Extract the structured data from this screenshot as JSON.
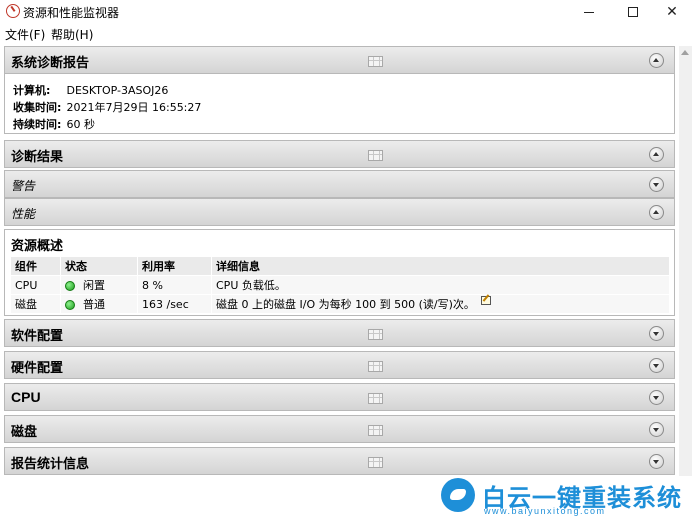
{
  "window": {
    "title": "资源和性能监视器"
  },
  "menu": {
    "file": "文件(F)",
    "help": "帮助(H)"
  },
  "report": {
    "title": "系统诊断报告",
    "computer_key": "计算机:",
    "computer_value": "DESKTOP-3ASOJ26",
    "collected_key": "收集时间:",
    "collected_value": "2021年7月29日  16:55:27",
    "duration_key": "持续时间:",
    "duration_value": "60 秒"
  },
  "sections": {
    "diagnostic_results": "诊断结果",
    "warning": "警告",
    "performance": "性能",
    "software_config": "软件配置",
    "hardware_config": "硬件配置",
    "cpu": "CPU",
    "disk": "磁盘",
    "report_stats": "报告统计信息"
  },
  "resource_overview": {
    "title": "资源概述",
    "columns": [
      "组件",
      "状态",
      "利用率",
      "详细信息"
    ],
    "rows": [
      {
        "component": "CPU",
        "status": "闲置",
        "utilization": "8 %",
        "details": "CPU 负载低。"
      },
      {
        "component": "磁盘",
        "status": "普通",
        "utilization": "163 /sec",
        "details": "磁盘  0 上的磁盘  I/O 为每秒  100 到  500 (读/写)次。"
      }
    ]
  },
  "watermark": {
    "title": "白云一键重装系统",
    "url": "www.baiyunxitong.com"
  },
  "colors": {
    "accent": "#1e8fd8",
    "status_ok": "#1c9c1c"
  }
}
